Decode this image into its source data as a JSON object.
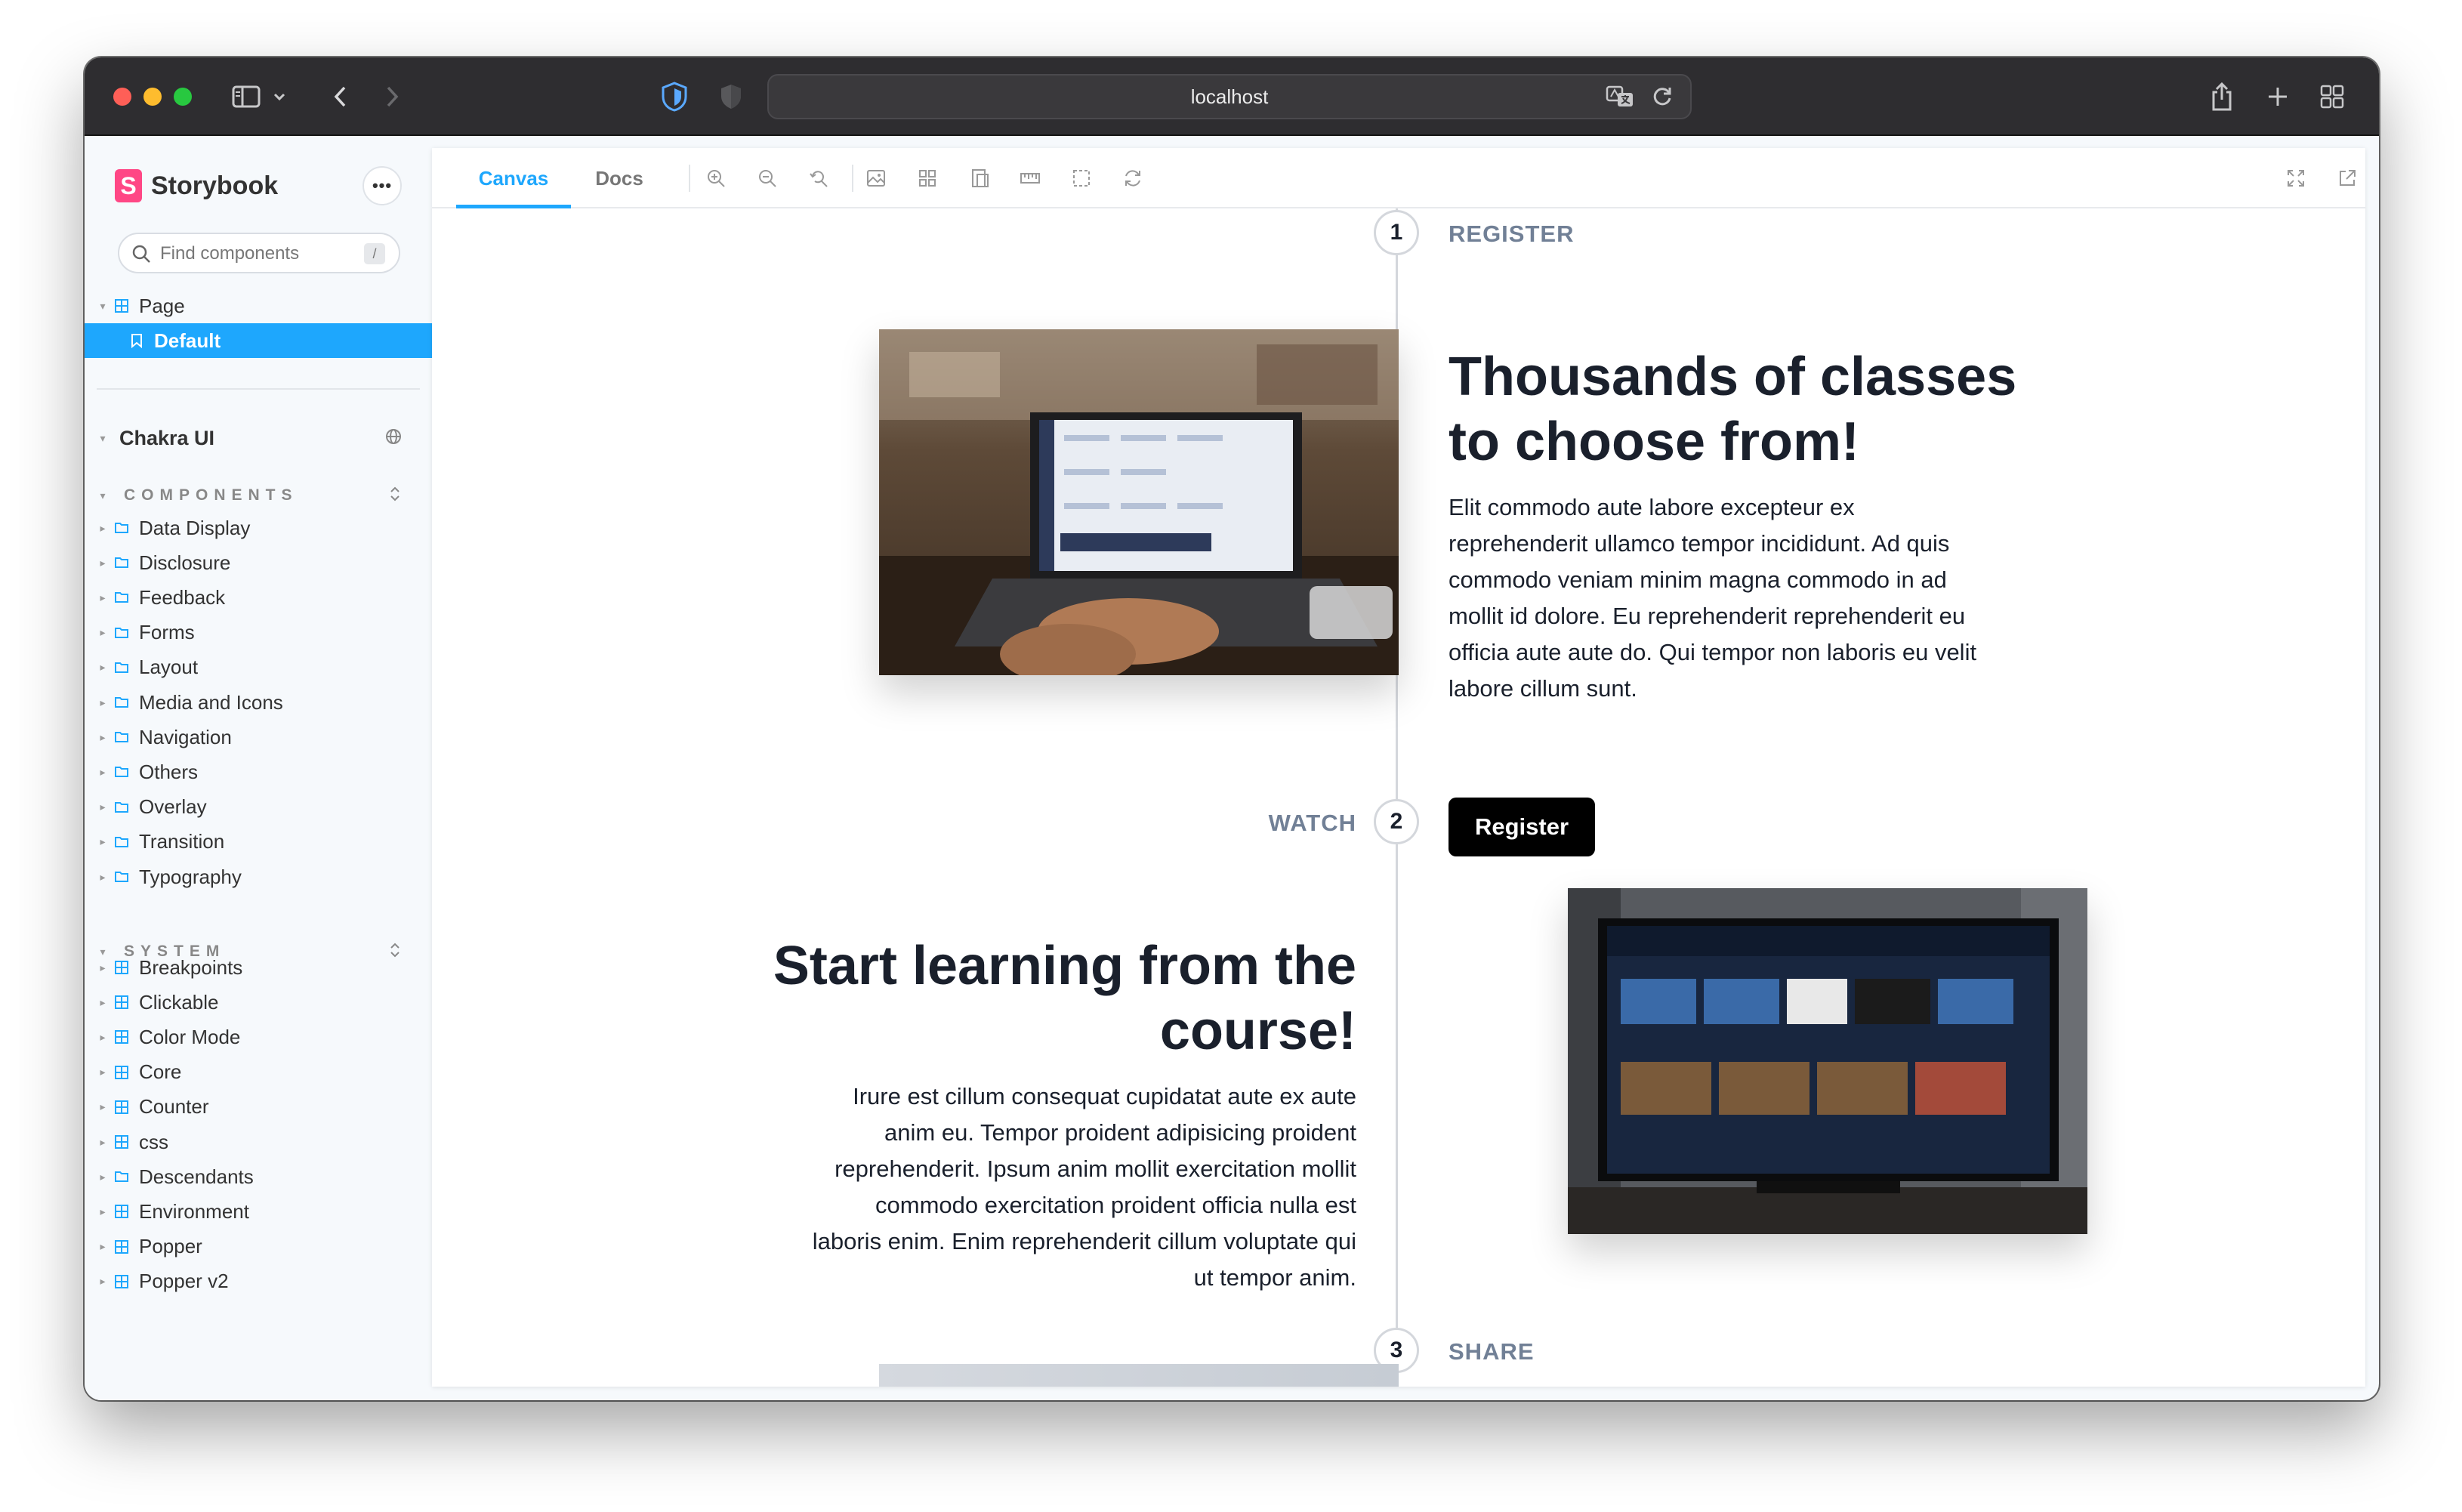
{
  "browser": {
    "url": "localhost"
  },
  "sidebar": {
    "brand": "Storybook",
    "brand_mark": "S",
    "search_placeholder": "Find components",
    "search_shortcut": "/",
    "page_group": {
      "label": "Page",
      "story": "Default"
    },
    "chakra_label": "Chakra UI",
    "components_title": "COMPONENTS",
    "components": [
      "Data Display",
      "Disclosure",
      "Feedback",
      "Forms",
      "Layout",
      "Media and Icons",
      "Navigation",
      "Others",
      "Overlay",
      "Transition",
      "Typography"
    ],
    "system_title": "SYSTEM",
    "system": [
      "Breakpoints",
      "Clickable",
      "Color Mode",
      "Core",
      "Counter",
      "css",
      "Descendants",
      "Environment",
      "Popper",
      "Popper v2"
    ]
  },
  "toolbar": {
    "tabs": [
      "Canvas",
      "Docs"
    ],
    "active_tab": "Canvas"
  },
  "canvas": {
    "steps": [
      {
        "number": "1",
        "label": "REGISTER"
      },
      {
        "number": "2",
        "label": "WATCH"
      },
      {
        "number": "3",
        "label": "SHARE"
      }
    ],
    "section1": {
      "heading_line1": "Thousands of classes",
      "heading_line2": "to choose from!",
      "body": [
        "Elit commodo aute labore excepteur ex",
        "reprehenderit ullamco tempor incididunt. Ad quis",
        "commodo veniam minim magna commodo in ad",
        "mollit id dolore. Eu reprehenderit reprehenderit eu",
        "officia aute aute do. Qui tempor non laboris eu velit",
        "labore cillum sunt."
      ],
      "button": "Register"
    },
    "section2": {
      "heading_line1": "Start learning from the",
      "heading_line2": "course!",
      "body": [
        "Irure est cillum consequat cupidatat aute ex aute",
        "anim eu. Tempor proident adipisicing proident",
        "reprehenderit. Ipsum anim mollit exercitation mollit",
        "commodo exercitation proident officia nulla est",
        "laboris enim. Enim reprehenderit cillum voluptate qui",
        "ut tempor anim."
      ]
    }
  },
  "colors": {
    "accent": "#1ea7fd",
    "brand": "#ff4785",
    "titlebar": "#2e2d30",
    "heading": "#1a202c",
    "step_label": "#718096"
  }
}
